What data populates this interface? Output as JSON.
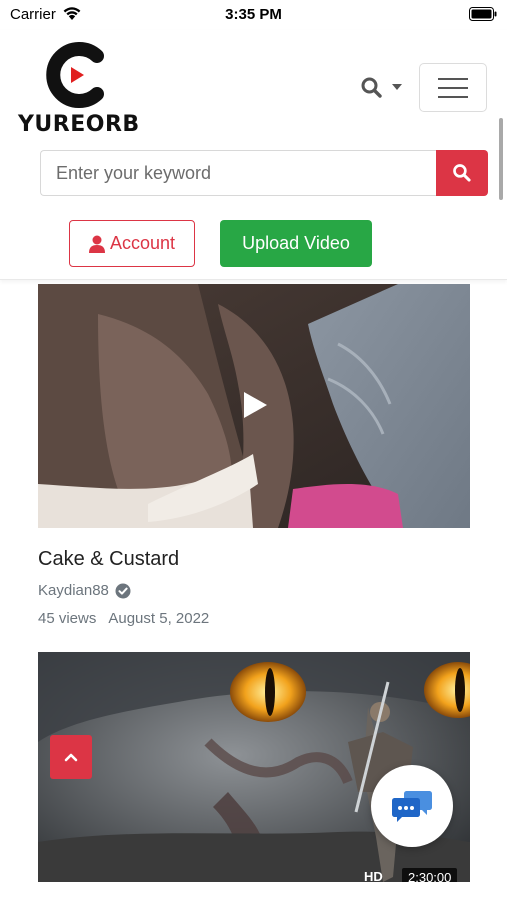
{
  "status_bar": {
    "carrier": "Carrier",
    "time": "3:35 PM",
    "icons": [
      "wifi-icon",
      "battery-icon"
    ]
  },
  "header": {
    "logo_text": "YUREORB",
    "search_placeholder": "Enter your keyword",
    "account_label": "Account",
    "upload_label": "Upload Video",
    "icons": [
      "search-icon",
      "caret-down-icon",
      "hamburger-menu-icon",
      "user-icon"
    ]
  },
  "videos": [
    {
      "title": "Cake & Custard",
      "channel": "Kaydian88",
      "verified": true,
      "views": "45 views",
      "date": "August 5, 2022"
    },
    {
      "hd_label": "HD",
      "duration": "2:30:00"
    }
  ],
  "floating": {
    "icons": [
      "chevron-up-icon",
      "chat-bubbles-icon"
    ]
  },
  "colors": {
    "accent_red": "#dc3545",
    "accent_green": "#28a745",
    "muted_text": "#6c757d"
  }
}
